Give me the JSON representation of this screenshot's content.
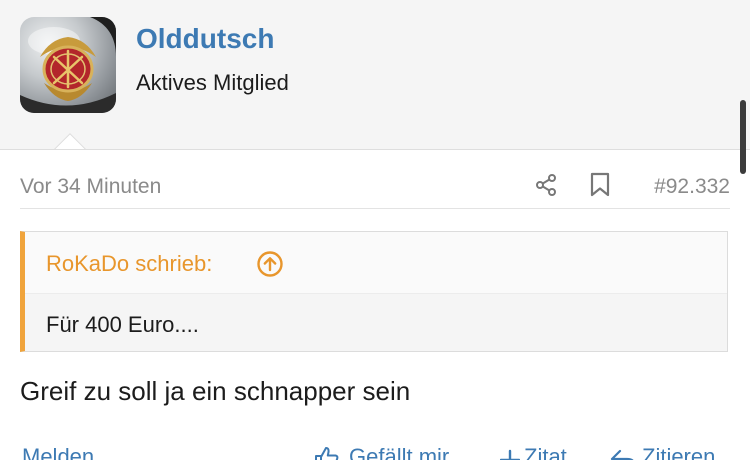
{
  "user": {
    "name": "Olddutsch",
    "title": "Aktives Mitglied",
    "avatar_icon": "bsa-tank-badge-avatar"
  },
  "post": {
    "time": "Vor 34 Minuten",
    "number": "#92.332",
    "share_icon": "share-icon",
    "bookmark_icon": "bookmark-icon",
    "body": "Greif zu soll ja ein schnapper sein"
  },
  "quote": {
    "author_line": "RoKaDo schrieb:",
    "text": "Für 400 Euro....",
    "accent_color": "#f0a43c"
  },
  "actions": {
    "report": "Melden",
    "like": "Gefällt mir",
    "multi_quote": "Zitat",
    "reply": "Zitieren"
  },
  "colors": {
    "link": "#3d7ab3",
    "meta_text": "#8a8a8a",
    "header_bg": "#f5f5f5"
  }
}
